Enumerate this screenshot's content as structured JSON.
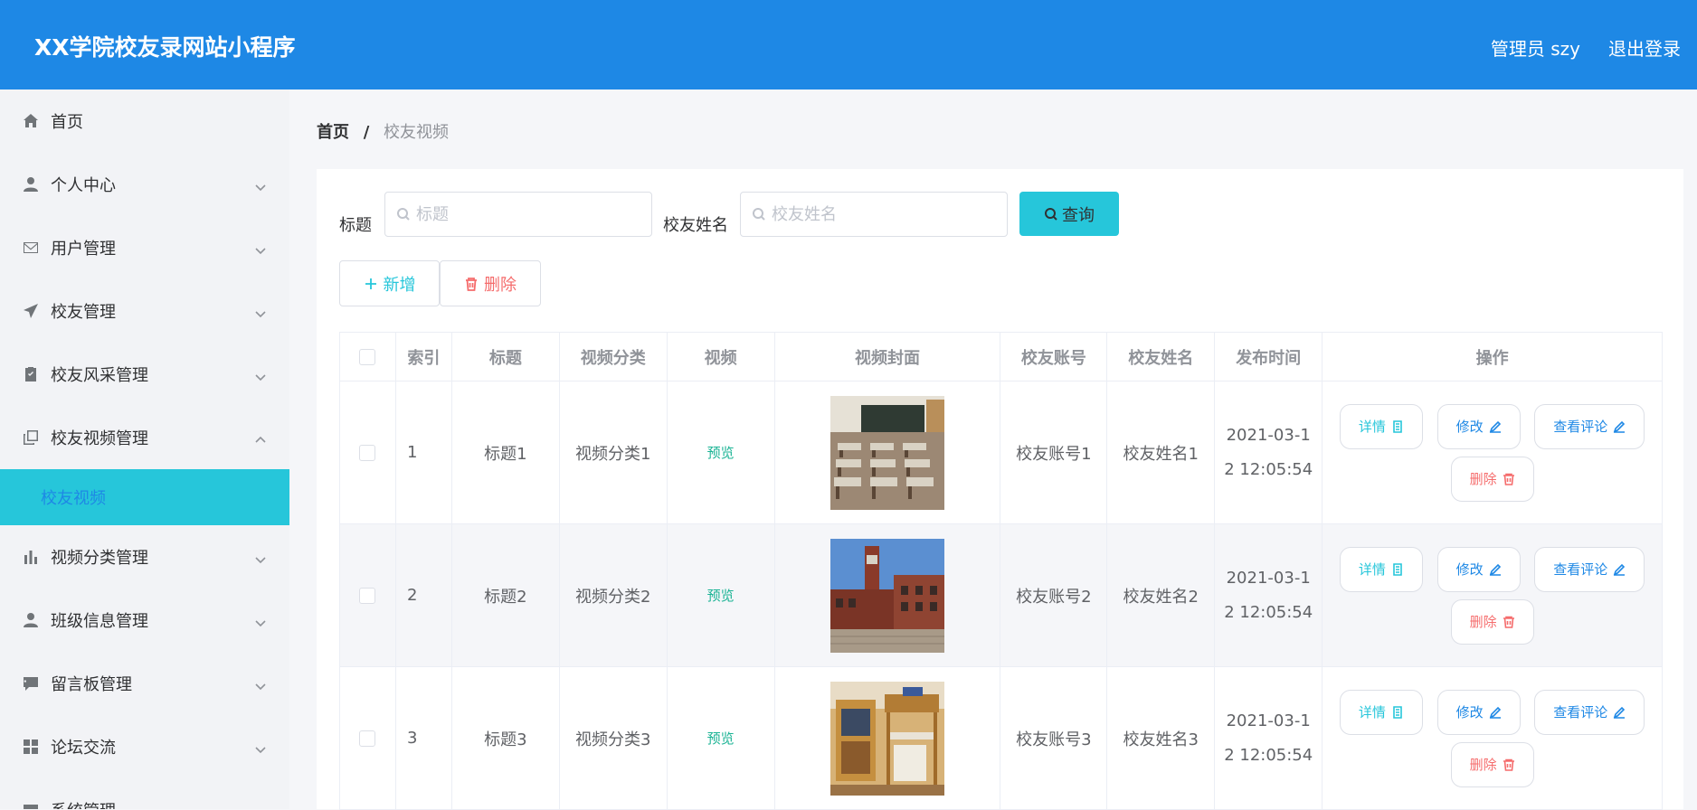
{
  "header": {
    "title": "XX学院校友录网站小程序",
    "user": "管理员 szy",
    "logout": "退出登录",
    "bg_color": "#1e88e5"
  },
  "sidebar": {
    "items": [
      {
        "label": "首页",
        "icon": "home-icon"
      },
      {
        "label": "个人中心",
        "icon": "user-icon"
      },
      {
        "label": "用户管理",
        "icon": "mail-icon"
      },
      {
        "label": "校友管理",
        "icon": "send-icon"
      },
      {
        "label": "校友风采管理",
        "icon": "clipboard-icon"
      },
      {
        "label": "校友视频管理",
        "icon": "copy-icon"
      },
      {
        "label": "视频分类管理",
        "icon": "bar-chart-icon"
      },
      {
        "label": "班级信息管理",
        "icon": "user-icon"
      },
      {
        "label": "留言板管理",
        "icon": "chat-icon"
      },
      {
        "label": "论坛交流",
        "icon": "grid-icon"
      },
      {
        "label": "系统管理",
        "icon": "settings-icon"
      }
    ],
    "active_sub": "校友视频",
    "active_color": "#26c6da"
  },
  "breadcrumb": {
    "home": "首页",
    "sep": "/",
    "current": "校友视频"
  },
  "search": {
    "title_label": "标题",
    "title_placeholder": "标题",
    "name_label": "校友姓名",
    "name_placeholder": "校友姓名",
    "query_btn": "查询"
  },
  "actions": {
    "add": "新增",
    "delete": "删除"
  },
  "table": {
    "columns": [
      "索引",
      "标题",
      "视频分类",
      "视频",
      "视频封面",
      "校友账号",
      "校友姓名",
      "发布时间",
      "操作"
    ],
    "rows": [
      {
        "index": "1",
        "title": "标题1",
        "category": "视频分类1",
        "video": "预览",
        "cover": "classroom",
        "account": "校友账号1",
        "name": "校友姓名1",
        "time_a": "2021-03-1",
        "time_b": "2 12:05:54"
      },
      {
        "index": "2",
        "title": "标题2",
        "category": "视频分类2",
        "video": "预览",
        "cover": "campus-building",
        "account": "校友账号2",
        "name": "校友姓名2",
        "time_a": "2021-03-1",
        "time_b": "2 12:05:54"
      },
      {
        "index": "3",
        "title": "标题3",
        "category": "视频分类3",
        "video": "预览",
        "cover": "dormitory",
        "account": "校友账号3",
        "name": "校友姓名3",
        "time_a": "2021-03-1",
        "time_b": "2 12:05:54"
      }
    ],
    "ops": {
      "detail": "详情",
      "edit": "修改",
      "comment": "查看评论",
      "remove": "删除"
    }
  }
}
